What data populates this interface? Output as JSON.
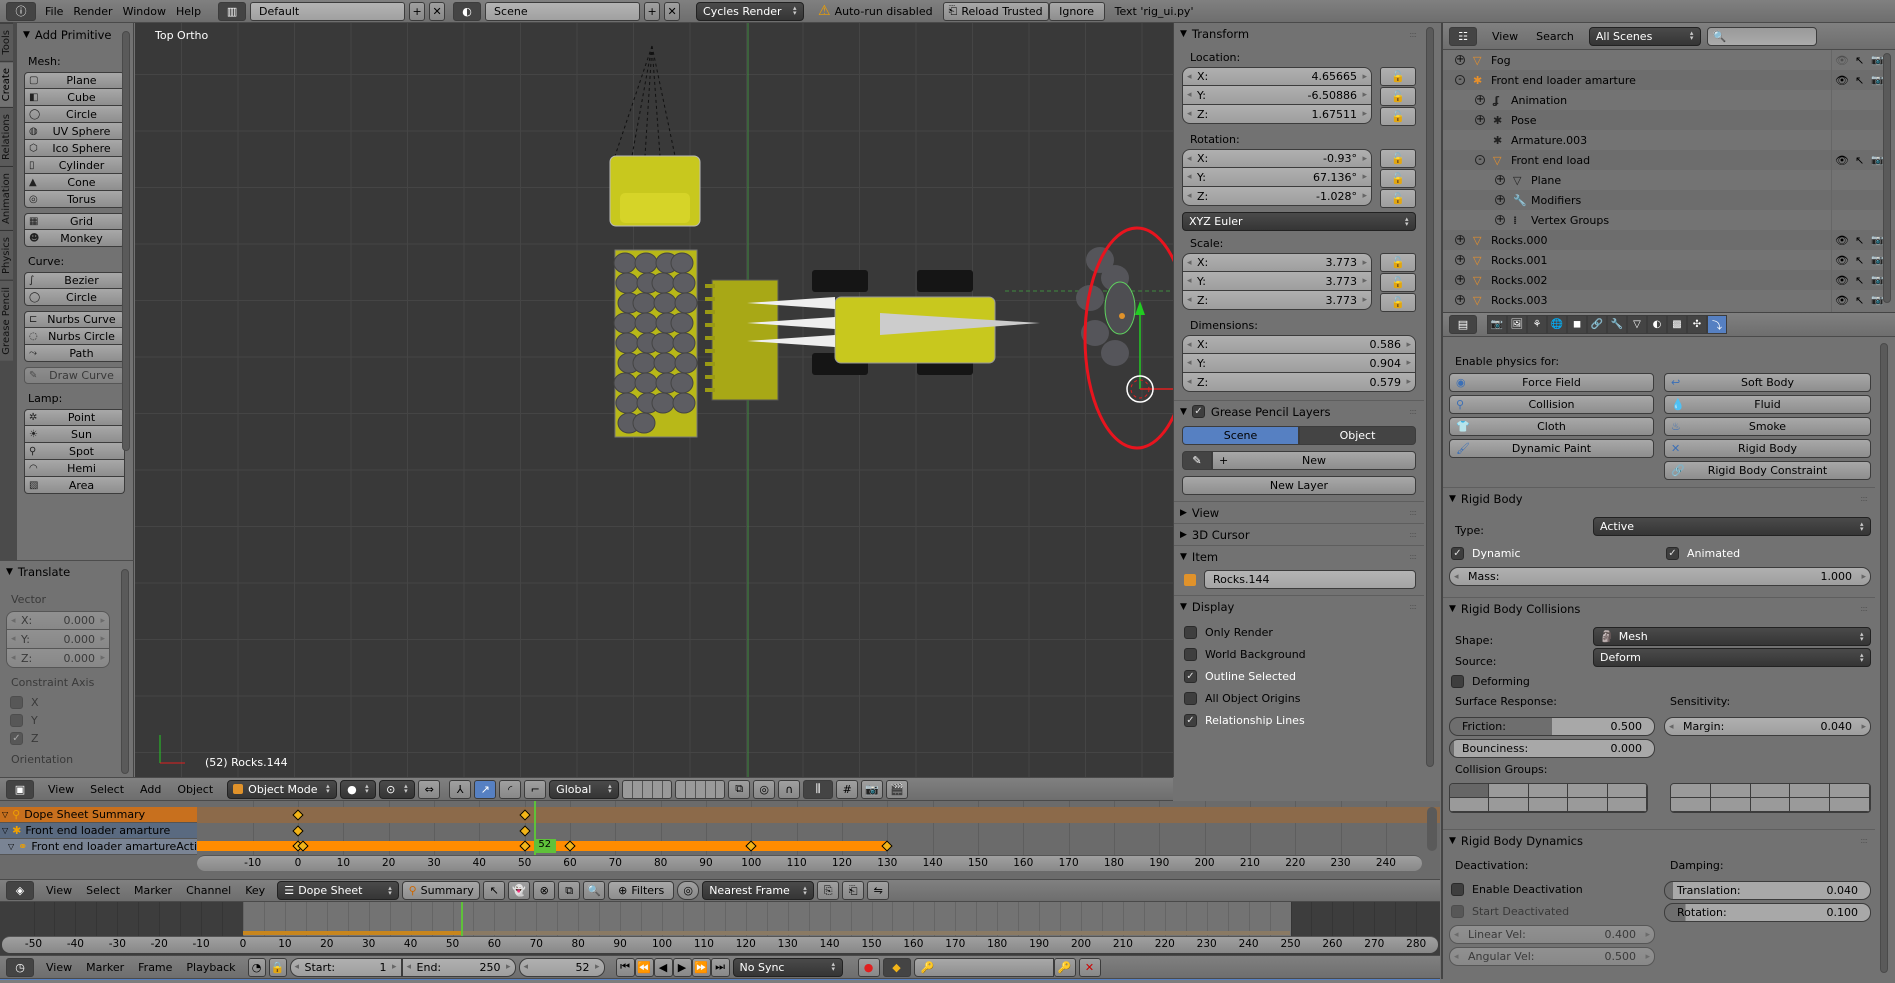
{
  "topbar": {
    "menus": [
      "File",
      "Render",
      "Window",
      "Help"
    ],
    "layout": "Default",
    "scene": "Scene",
    "engine": "Cycles Render",
    "warning": "Auto-run disabled",
    "reload_trusted": "Reload Trusted",
    "ignore": "Ignore",
    "text_note": "Text 'rig_ui.py'"
  },
  "toolbar": {
    "tabs": [
      "Tools",
      "Create",
      "Relations",
      "Animation",
      "Physics",
      "Grease Pencil"
    ],
    "active_tab": "Create",
    "panel_title": "Add Primitive",
    "groups": [
      {
        "label": "Mesh:",
        "blocks": [
          [
            "Plane",
            "Cube",
            "Circle",
            "UV Sphere",
            "Ico Sphere",
            "Cylinder",
            "Cone",
            "Torus"
          ],
          [
            "Grid",
            "Monkey"
          ]
        ]
      },
      {
        "label": "Curve:",
        "blocks": [
          [
            "Bezier",
            "Circle"
          ],
          [
            "Nurbs Curve",
            "Nurbs Circle",
            "Path"
          ],
          [
            "Draw Curve"
          ]
        ]
      },
      {
        "label": "Lamp:",
        "blocks": [
          [
            "Point",
            "Sun",
            "Spot",
            "Hemi",
            "Area"
          ]
        ]
      }
    ],
    "disabled": [
      "Draw Curve"
    ],
    "translate": {
      "title": "Translate",
      "vector_label": "Vector",
      "vector": [
        {
          "axis": "X:",
          "value": "0.000"
        },
        {
          "axis": "Y:",
          "value": "0.000"
        },
        {
          "axis": "Z:",
          "value": "0.000"
        }
      ],
      "constraint_label": "Constraint Axis",
      "constraints": [
        {
          "label": "X",
          "checked": false
        },
        {
          "label": "Y",
          "checked": false
        },
        {
          "label": "Z",
          "checked": true
        }
      ],
      "orientation_label": "Orientation"
    }
  },
  "viewport": {
    "view_label": "Top Ortho",
    "object_label": "(52) Rocks.144",
    "selection_color": "#e8141e",
    "grid_color": "#454545",
    "background": "#393939"
  },
  "npanel": {
    "transform_title": "Transform",
    "location_label": "Location:",
    "location": [
      {
        "axis": "X:",
        "value": "4.65665"
      },
      {
        "axis": "Y:",
        "value": "-6.50886"
      },
      {
        "axis": "Z:",
        "value": "1.67511"
      }
    ],
    "rotation_label": "Rotation:",
    "rotation": [
      {
        "axis": "X:",
        "value": "-0.93°"
      },
      {
        "axis": "Y:",
        "value": "67.136°"
      },
      {
        "axis": "Z:",
        "value": "-1.028°"
      }
    ],
    "rotation_mode": "XYZ Euler",
    "scale_label": "Scale:",
    "scale": [
      {
        "axis": "X:",
        "value": "3.773"
      },
      {
        "axis": "Y:",
        "value": "3.773"
      },
      {
        "axis": "Z:",
        "value": "3.773"
      }
    ],
    "dimensions_label": "Dimensions:",
    "dimensions": [
      {
        "axis": "X:",
        "value": "0.586"
      },
      {
        "axis": "Y:",
        "value": "0.904"
      },
      {
        "axis": "Z:",
        "value": "0.579"
      }
    ],
    "gp_title": "Grease Pencil Layers",
    "gp_scene": "Scene",
    "gp_object": "Object",
    "gp_new": "New",
    "gp_new_layer": "New Layer",
    "view_title": "View",
    "cursor_title": "3D Cursor",
    "item_title": "Item",
    "item_name": "Rocks.144",
    "display_title": "Display",
    "display_options": [
      {
        "label": "Only Render",
        "checked": false
      },
      {
        "label": "World Background",
        "checked": false
      },
      {
        "label": "Outline Selected",
        "checked": true
      },
      {
        "label": "All Object Origins",
        "checked": false
      },
      {
        "label": "Relationship Lines",
        "checked": true
      }
    ]
  },
  "viewport_header": {
    "menus": [
      "View",
      "Select",
      "Add",
      "Object"
    ],
    "mode": "Object Mode",
    "orientation": "Global"
  },
  "outliner": {
    "menus": [
      "View",
      "Search"
    ],
    "filter": "All Scenes",
    "search_placeholder": "",
    "rows": [
      {
        "name": "Fog",
        "level": 0,
        "icon": "mesh-object-icon",
        "toggle": "+",
        "vis": true,
        "dim": true
      },
      {
        "name": "Front end loader amarture",
        "level": 0,
        "icon": "armature-object-icon",
        "toggle": "-",
        "vis": true
      },
      {
        "name": "Animation",
        "level": 1,
        "icon": "animation-icon",
        "toggle": "+",
        "vis": false
      },
      {
        "name": "Pose",
        "level": 1,
        "icon": "pose-icon",
        "toggle": "+",
        "vis": false
      },
      {
        "name": "Armature.003",
        "level": 1,
        "icon": "armature-data-icon",
        "toggle": "",
        "vis": false
      },
      {
        "name": "Front end load",
        "level": 1,
        "icon": "mesh-object-icon",
        "toggle": "-",
        "vis": true
      },
      {
        "name": "Plane",
        "level": 2,
        "icon": "mesh-data-icon",
        "toggle": "+",
        "vis": false
      },
      {
        "name": "Modifiers",
        "level": 2,
        "icon": "wrench-icon",
        "toggle": "+",
        "vis": false
      },
      {
        "name": "Vertex Groups",
        "level": 2,
        "icon": "vertex-groups-icon",
        "toggle": "+",
        "vis": false
      },
      {
        "name": "Rocks.000",
        "level": 0,
        "icon": "mesh-object-icon",
        "toggle": "+",
        "vis": true
      },
      {
        "name": "Rocks.001",
        "level": 0,
        "icon": "mesh-object-icon",
        "toggle": "+",
        "vis": true
      },
      {
        "name": "Rocks.002",
        "level": 0,
        "icon": "mesh-object-icon",
        "toggle": "+",
        "vis": true
      },
      {
        "name": "Rocks.003",
        "level": 0,
        "icon": "mesh-object-icon",
        "toggle": "+",
        "vis": true
      }
    ]
  },
  "properties": {
    "tabs": [
      "render",
      "render-layers",
      "scene",
      "world",
      "object",
      "constraints",
      "modifiers",
      "data",
      "material",
      "texture",
      "particles",
      "physics"
    ],
    "active_tab": "physics",
    "enable_label": "Enable physics for:",
    "physics_buttons_left": [
      "Force Field",
      "Collision",
      "Cloth",
      "Dynamic Paint"
    ],
    "physics_buttons_right": [
      "Soft Body",
      "Fluid",
      "Smoke",
      "Rigid Body",
      "Rigid Body Constraint"
    ],
    "rigid_body": {
      "title": "Rigid Body",
      "type_label": "Type:",
      "type": "Active",
      "dynamic": "Dynamic",
      "animated": "Animated",
      "mass_label": "Mass:",
      "mass": "1.000"
    },
    "collisions": {
      "title": "Rigid Body Collisions",
      "shape_label": "Shape:",
      "shape": "Mesh",
      "source_label": "Source:",
      "source": "Deform",
      "deforming": "Deforming",
      "surface_label": "Surface Response:",
      "sensitivity_label": "Sensitivity:",
      "friction_label": "Friction:",
      "friction": "0.500",
      "friction_fill": 0.5,
      "bounciness_label": "Bounciness:",
      "bounciness": "0.000",
      "margin_label": "Margin:",
      "margin": "0.040",
      "groups_label": "Collision Groups:",
      "active_group": 0
    },
    "dynamics": {
      "title": "Rigid Body Dynamics",
      "deactivation_label": "Deactivation:",
      "damping_label": "Damping:",
      "enable_deactivation": "Enable Deactivation",
      "start_deactivated": "Start Deactivated",
      "linear_label": "Linear Vel:",
      "linear": "0.400",
      "angular_label": "Angular Vel:",
      "angular": "0.500",
      "translation_label": "Translation:",
      "translation": "0.040",
      "translation_fill": 0.04,
      "rotation_label": "Rotation:",
      "rotation": "0.100",
      "rotation_fill": 0.1
    }
  },
  "dopesheet": {
    "channels": [
      "Dope Sheet Summary",
      "Front end loader amarture",
      "Front end loader amartureActio"
    ],
    "ruler_min": -10,
    "ruler_max": 240,
    "ruler_step": 10,
    "current_frame": "52",
    "current_frame_value": 52,
    "summary_keys": [
      0,
      50
    ],
    "armature_keys": [
      0,
      50
    ],
    "action_keys": [
      0,
      1,
      50,
      60,
      100,
      130
    ],
    "action_range": [
      0,
      130
    ],
    "menus": [
      "View",
      "Select",
      "Marker",
      "Channel",
      "Key"
    ],
    "mode": "Dope Sheet",
    "summary": "Summary",
    "filters": "Filters",
    "snap": "Nearest Frame"
  },
  "timeline": {
    "ruler_min": -50,
    "ruler_max": 280,
    "ruler_step": 10,
    "range": [
      1,
      250
    ],
    "current": 52,
    "menus": [
      "View",
      "Marker",
      "Frame",
      "Playback"
    ],
    "start_label": "Start:",
    "start": "1",
    "end_label": "End:",
    "end": "250",
    "frame": "52",
    "sync": "No Sync"
  }
}
